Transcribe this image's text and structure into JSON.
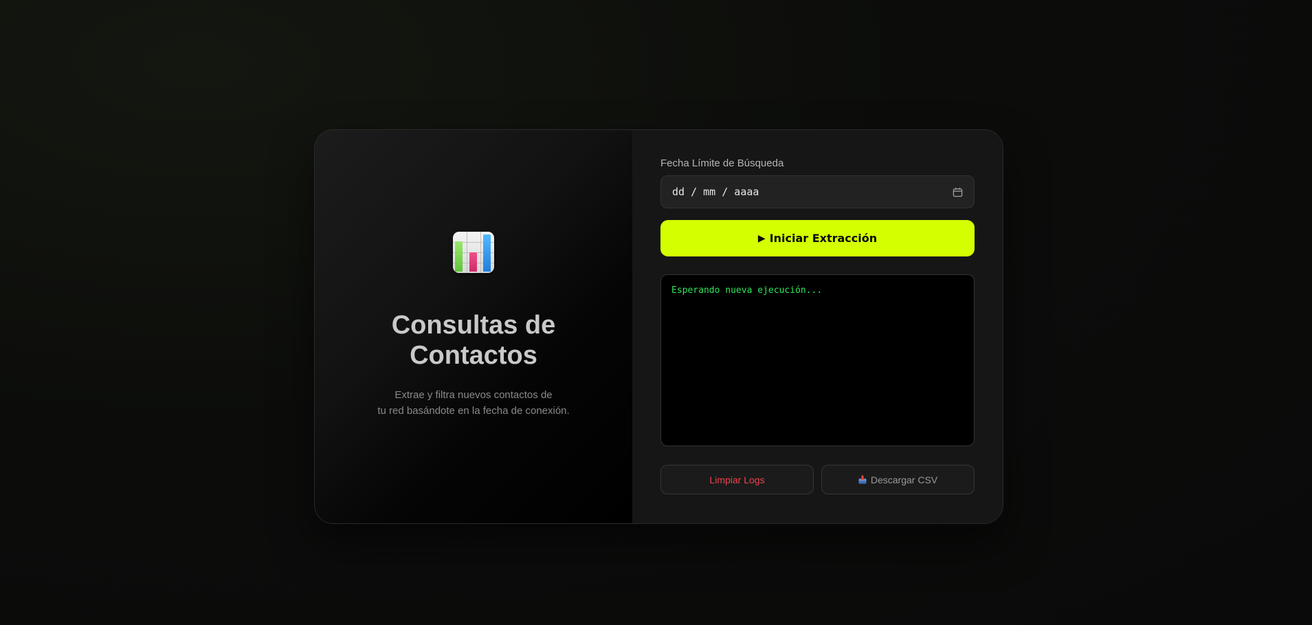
{
  "left_panel": {
    "title_line1": "Consultas de",
    "title_line2": "Contactos",
    "subtitle_line1": "Extrae y filtra nuevos contactos de",
    "subtitle_line2": "tu red basándote en la fecha de conexión.",
    "icon": "bar-chart-icon"
  },
  "form": {
    "date_label": "Fecha Límite de Búsqueda",
    "date_placeholder": "dd / mm / aaaa",
    "calendar_icon": "calendar-icon",
    "start_icon": "▶",
    "start_label": "Iniciar Extracción"
  },
  "console": {
    "log_text": "Esperando nueva ejecución..."
  },
  "actions": {
    "clear_label": "Limpiar Logs",
    "download_label": "Descargar CSV",
    "download_icon": "inbox-tray-icon"
  },
  "colors": {
    "accent": "#d4ff00",
    "log_text": "#2ee65a",
    "danger": "#f0424a",
    "panel_dark": "#161616",
    "background": "#0a0a0a"
  }
}
